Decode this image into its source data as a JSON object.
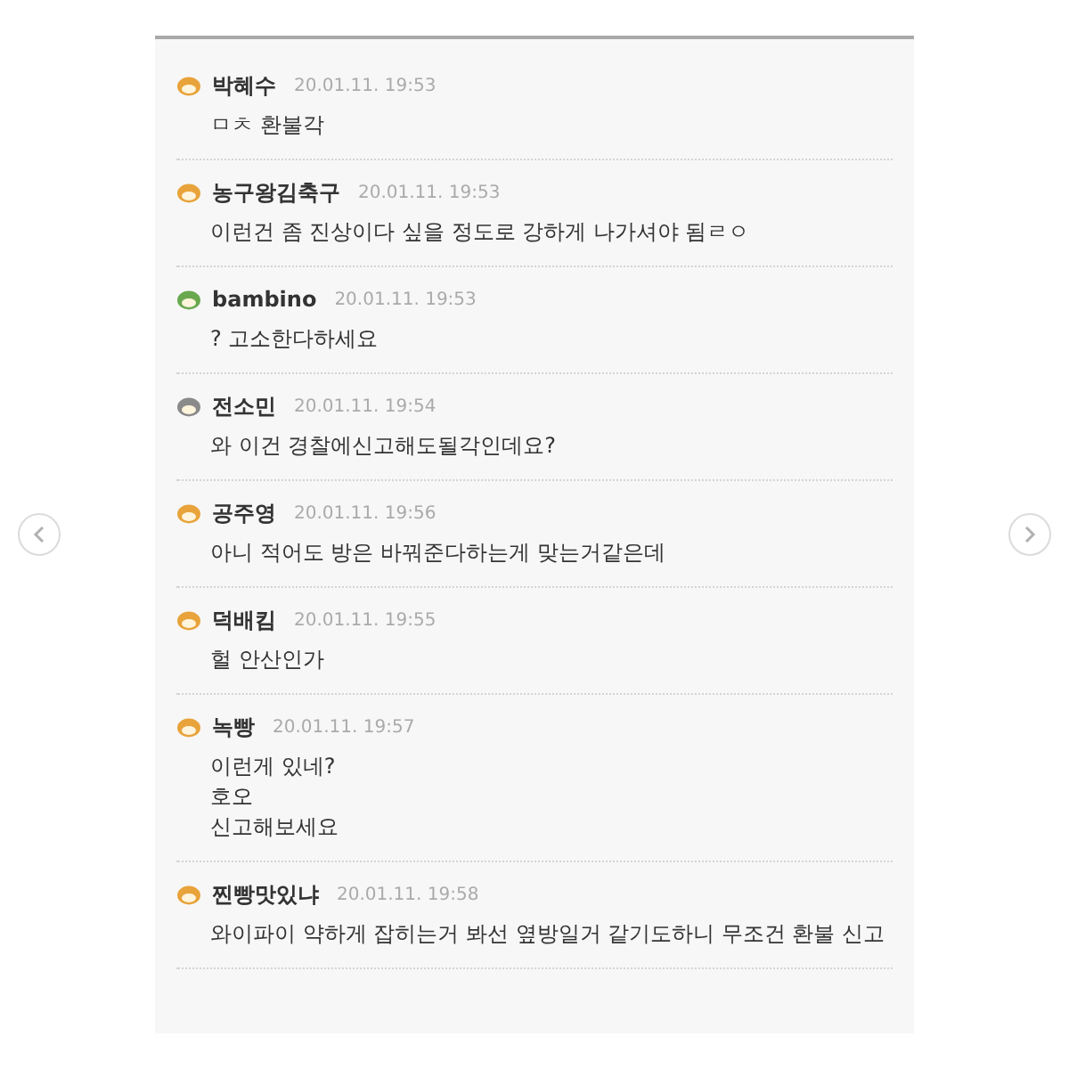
{
  "comments": [
    {
      "author": "박혜수",
      "time": "20.01.11. 19:53",
      "color": "#e8a33a",
      "lines": [
        "ㅁㅊ 환불각"
      ]
    },
    {
      "author": "농구왕김축구",
      "time": "20.01.11. 19:53",
      "color": "#e8a33a",
      "lines": [
        "이런건 좀 진상이다 싶을 정도로 강하게 나가셔야 됨ㄹㅇ"
      ]
    },
    {
      "author": "bambino",
      "time": "20.01.11. 19:53",
      "color": "#6aa84f",
      "lines": [
        "? 고소한다하세요"
      ]
    },
    {
      "author": "전소민",
      "time": "20.01.11. 19:54",
      "color": "#8a8a8a",
      "lines": [
        "와 이건 경찰에신고해도될각인데요?"
      ]
    },
    {
      "author": "공주영",
      "time": "20.01.11. 19:56",
      "color": "#e8a33a",
      "lines": [
        "아니 적어도 방은 바꿔준다하는게 맞는거같은데"
      ]
    },
    {
      "author": "덕배킴",
      "time": "20.01.11. 19:55",
      "color": "#e8a33a",
      "lines": [
        "헐 안산인가"
      ]
    },
    {
      "author": "녹빵",
      "time": "20.01.11. 19:57",
      "color": "#e8a33a",
      "lines": [
        "이런게 있네?",
        "호오",
        "신고해보세요"
      ]
    },
    {
      "author": "찐빵맛있냐",
      "time": "20.01.11. 19:58",
      "color": "#e8a33a",
      "lines": [
        "와이파이 약하게 잡히는거 봐선 옆방일거 같기도하니 무조건 환불 신고"
      ]
    }
  ]
}
